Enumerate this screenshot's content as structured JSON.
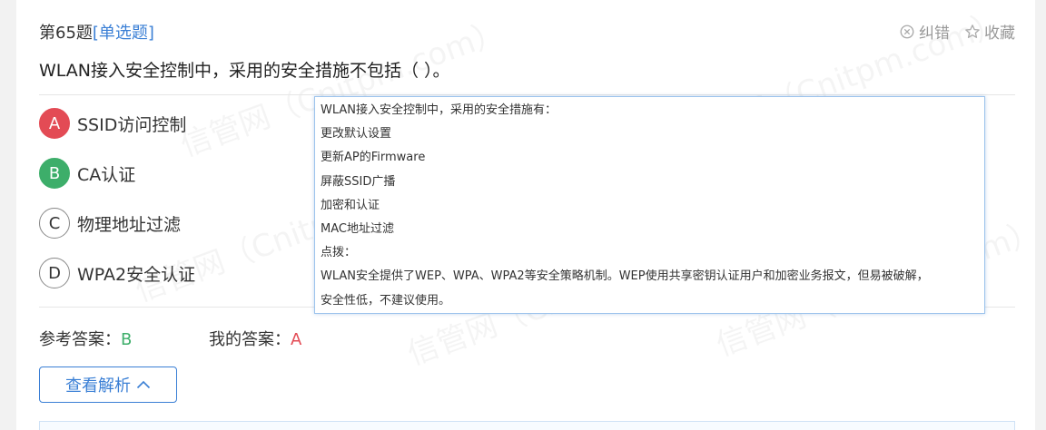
{
  "question": {
    "number_label": "第65题",
    "type_label": "[单选题]",
    "stem": "WLAN接入安全控制中，采用的安全措施不包括（ ）。"
  },
  "toolbar": {
    "report_label": "纠错",
    "favorite_label": "收藏"
  },
  "options": [
    {
      "letter": "A",
      "text": "SSID访问控制",
      "state": "wrong"
    },
    {
      "letter": "B",
      "text": "CA认证",
      "state": "correct"
    },
    {
      "letter": "C",
      "text": "物理地址过滤",
      "state": "normal"
    },
    {
      "letter": "D",
      "text": "WPA2安全认证",
      "state": "normal"
    }
  ],
  "popup_lines": [
    "WLAN接入安全控制中，采用的安全措施有：",
    "更改默认设置",
    "更新AP的Firmware",
    "屏蔽SSID广播",
    "加密和认证",
    "MAC地址过滤",
    "点拨：",
    "WLAN安全提供了WEP、WPA、WPA2等安全策略机制。WEP使用共享密钥认证用户和加密业务报文，但易被破解，",
    "安全性低，不建议使用。"
  ],
  "answers": {
    "reference_label": "参考答案：",
    "reference_value": "B",
    "mine_label": "我的答案：",
    "mine_value": "A"
  },
  "analysis_button_label": "查看解析",
  "watermark": "信管网（Cnitpm.com）",
  "colors": {
    "accent": "#3a7fd5",
    "correct": "#3dae6a",
    "wrong": "#e34b55"
  }
}
